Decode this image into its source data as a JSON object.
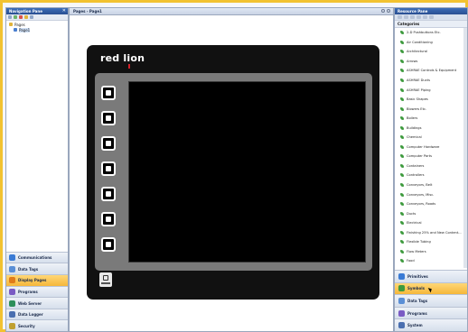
{
  "navigation_pane": {
    "title": "Navigation Pane",
    "close": "✕",
    "tree": {
      "root": "Pages",
      "child": "Page1"
    },
    "buttons": [
      {
        "label": "Communications",
        "icon": "communications-icon",
        "color": "#3a7bd5"
      },
      {
        "label": "Data Tags",
        "icon": "data-tags-icon",
        "color": "#5a8fd6"
      },
      {
        "label": "Display Pages",
        "icon": "display-pages-icon",
        "color": "#e07b1a",
        "active": true
      },
      {
        "label": "Programs",
        "icon": "programs-icon",
        "color": "#7a5bc4"
      },
      {
        "label": "Web Server",
        "icon": "web-server-icon",
        "color": "#2d8f5a"
      },
      {
        "label": "Data Logger",
        "icon": "data-logger-icon",
        "color": "#4a6fb0"
      },
      {
        "label": "Security",
        "icon": "security-icon",
        "color": "#c0a030"
      }
    ]
  },
  "center": {
    "tab_title": "Pages - Page1",
    "device": {
      "logo": "red lion"
    }
  },
  "resource_pane": {
    "title": "Resource Pane",
    "categories_header": "Categories",
    "categories": [
      "2-D Pushbuttons Etc.",
      "Air Conditioning",
      "Architectural",
      "Arrows",
      "ASHRAE Controls & Equipment",
      "ASHRAE Ducts",
      "ASHRAE Piping",
      "Basic Shapes",
      "Blowers Etc.",
      "Boilers",
      "Buildings",
      "Chemical",
      "Computer Hardware",
      "Computer Parts",
      "Containers",
      "Controllers",
      "Conveyors, Belt",
      "Conveyors, Misc.",
      "Conveyors, Roads",
      "Ducts",
      "Electrical",
      "Finishing 25% and New Content...",
      "Flexible Tubing",
      "Flow Meters",
      "Food",
      "Gadget Screen Indicators",
      "Gadget Buttons 1"
    ],
    "buttons": [
      {
        "label": "Primitives",
        "icon": "primitives-icon",
        "color": "#3a7bd5"
      },
      {
        "label": "Symbols",
        "icon": "symbols-icon",
        "color": "#3d9a3d",
        "active": true
      },
      {
        "label": "Data Tags",
        "icon": "data-tags-icon",
        "color": "#5a8fd6"
      },
      {
        "label": "Programs",
        "icon": "programs-icon",
        "color": "#7a5bc4"
      },
      {
        "label": "System",
        "icon": "system-icon",
        "color": "#4a6fb0"
      }
    ]
  },
  "colors": {
    "frame_border": "#f2c230",
    "active_button": "#f5b73b",
    "pane_title": "#2a4f92",
    "device_body": "#111111",
    "bezel": "#7a7a7a"
  }
}
